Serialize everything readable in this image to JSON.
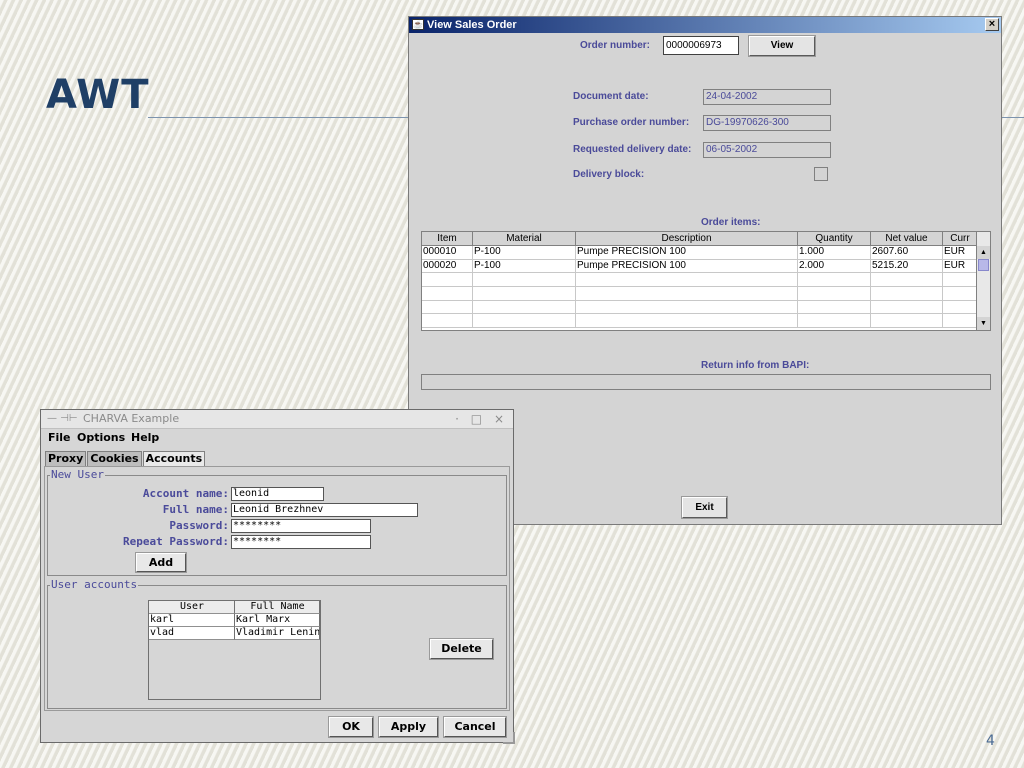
{
  "slide": {
    "title": "AWT",
    "page_number": "4"
  },
  "sales_order": {
    "window_title": "View Sales Order",
    "order_number_label": "Order number:",
    "order_number_value": "0000006973",
    "view_button": "View",
    "document_date_label": "Document date:",
    "document_date_value": "24-04-2002",
    "purchase_order_label": "Purchase order number:",
    "purchase_order_value": "DG-19970626-300",
    "requested_delivery_label": "Requested delivery date:",
    "requested_delivery_value": "06-05-2002",
    "delivery_block_label": "Delivery block:",
    "order_items_label": "Order items:",
    "columns": [
      "Item",
      "Material",
      "Description",
      "Quantity",
      "Net value",
      "Curr"
    ],
    "rows": [
      [
        "000010",
        "P-100",
        "Pumpe PRECISION 100",
        "1.000",
        "2607.60",
        "EUR"
      ],
      [
        "000020",
        "P-100",
        "Pumpe PRECISION 100",
        "2.000",
        "5215.20",
        "EUR"
      ],
      [
        "",
        "",
        "",
        "",
        "",
        ""
      ],
      [
        "",
        "",
        "",
        "",
        "",
        ""
      ],
      [
        "",
        "",
        "",
        "",
        "",
        ""
      ],
      [
        "",
        "",
        "",
        "",
        "",
        ""
      ]
    ],
    "return_info_label": "Return info from BAPI:",
    "exit_button": "Exit"
  },
  "charva": {
    "window_title": "CHARVA Example",
    "menu": [
      "File",
      "Options",
      "Help"
    ],
    "tabs": [
      "Proxy",
      "Cookies",
      "Accounts"
    ],
    "new_user_group": "New User",
    "account_name_label": "Account name:",
    "account_name_value": "leonid",
    "full_name_label": "Full name:",
    "full_name_value": "Leonid Brezhnev",
    "password_label": "Password:",
    "password_value": "********",
    "repeat_password_label": "Repeat Password:",
    "repeat_password_value": "********",
    "add_button": "Add",
    "user_accounts_group": "User accounts",
    "table_columns": [
      "User",
      "Full Name"
    ],
    "users": [
      [
        "karl",
        "Karl Marx"
      ],
      [
        "vlad",
        "Vladimir Lenin"
      ]
    ],
    "delete_button": "Delete",
    "ok_button": "OK",
    "apply_button": "Apply",
    "cancel_button": "Cancel"
  }
}
